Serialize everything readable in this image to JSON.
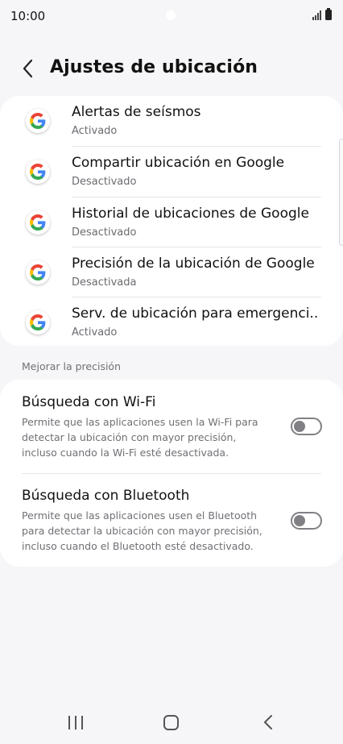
{
  "status": {
    "time": "10:00"
  },
  "header": {
    "title": "Ajustes de ubicación"
  },
  "apps": [
    {
      "title": "Alertas de seísmos",
      "status": "Activado"
    },
    {
      "title": "Compartir ubicación en Google",
      "status": "Desactivado"
    },
    {
      "title": "Historial de ubicaciones de Google",
      "status": "Desactivado"
    },
    {
      "title": "Precisión de la ubicación de Google",
      "status": "Desactivada"
    },
    {
      "title": "Serv. de ubicación para emergenci..",
      "status": "Activado"
    }
  ],
  "section": {
    "label": "Mejorar la precisión"
  },
  "options": [
    {
      "title": "Búsqueda con Wi-Fi",
      "desc_lines": [
        "Permite que las aplicaciones usen la Wi-Fi para",
        "detectar la ubicación con mayor precisión,",
        "incluso cuando la Wi-Fi esté desactivada."
      ],
      "enabled": false
    },
    {
      "title": "Búsqueda con Bluetooth",
      "desc_lines": [
        "Permite que las aplicaciones usen el Bluetooth",
        "para detectar la ubicación con mayor precisión,",
        "incluso cuando el Bluetooth esté desactivado."
      ],
      "enabled": false
    }
  ],
  "icons": {
    "app_icon": "google-g-icon",
    "back": "chevron-left-icon",
    "nav_recent": "recent-apps-icon",
    "nav_home": "home-icon",
    "nav_back": "back-icon"
  },
  "colors": {
    "background": "#f6f6f8",
    "card": "#ffffff",
    "toggle_off": "#808085",
    "google_blue": "#4285F4",
    "google_red": "#EA4335",
    "google_yellow": "#FBBC05",
    "google_green": "#34A853"
  }
}
